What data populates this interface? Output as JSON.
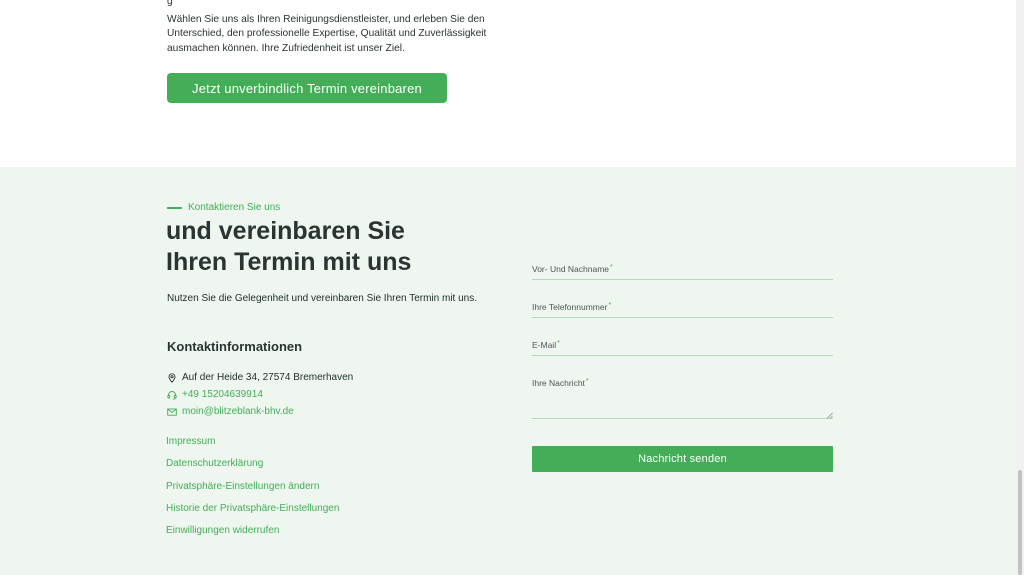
{
  "top": {
    "cut_glyph": "g",
    "paragraph": "Wählen Sie uns als Ihren Reinigungsdienstleister, und erleben Sie den Unterschied, den professionelle Expertise, Qualität und Zuverlässigkeit ausmachen können. Ihre Zufriedenheit ist unser Ziel.",
    "cta_label": "Jetzt unverbindlich Termin vereinbaren"
  },
  "contact": {
    "eyebrow": "Kontaktieren Sie uns",
    "headline_line1": "und vereinbaren Sie",
    "headline_line2": "Ihren Termin mit uns",
    "intro": "Nutzen Sie die Gelegenheit und vereinbaren Sie Ihren Termin mit uns.",
    "info_heading": "Kontaktinformationen",
    "address": "Auf der Heide 34, 27574 Bremerhaven",
    "phone": "+49 15204639914",
    "email": "moin@blitzeblank-bhv.de",
    "links": [
      "Impressum",
      "Datenschutzerklärung",
      "Privatsphäre-Einstellungen ändern",
      "Historie der Privatsphäre-Einstellungen",
      "Einwilligungen widerrufen"
    ]
  },
  "form": {
    "name_label": "Vor- Und Nachname",
    "phone_label": "Ihre Telefonnummer",
    "email_label": "E-Mail",
    "message_label": "Ihre Nachricht",
    "required_mark": "*",
    "submit_label": "Nachricht senden"
  },
  "icons": {
    "address": "map-pin-icon",
    "phone": "headset-icon",
    "email": "envelope-icon"
  },
  "colors": {
    "accent": "#43ad58",
    "section_background": "#eef6ef",
    "text_dark": "#2a3432"
  }
}
